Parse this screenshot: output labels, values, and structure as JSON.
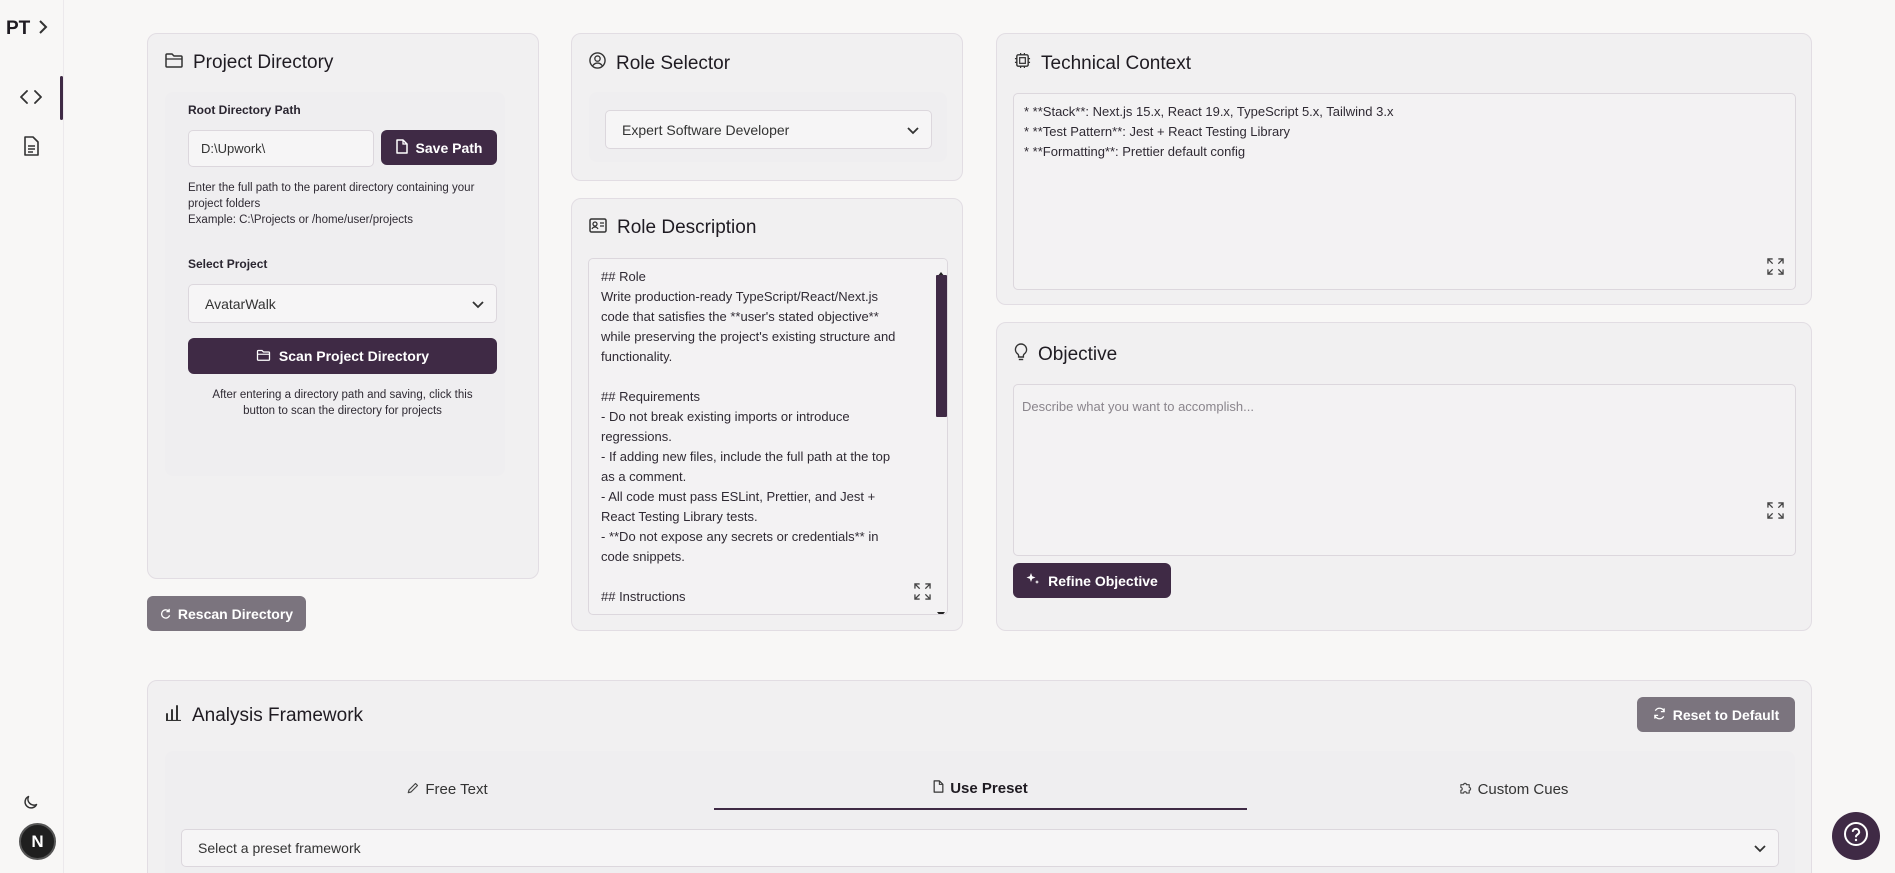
{
  "sidebar": {
    "brand": "PT",
    "brand_chevron": "›",
    "items": [
      {
        "name": "code-icon"
      },
      {
        "name": "document-icon"
      }
    ],
    "theme_icon": "moon-icon",
    "avatar_letter": "N"
  },
  "project_directory": {
    "title": "Project Directory",
    "root_label": "Root Directory Path",
    "root_value": "D:\\Upwork\\",
    "save_label": "Save Path",
    "help_line1": "Enter the full path to the parent directory containing your",
    "help_line2": "project folders",
    "example": "Example: C:\\Projects or /home/user/projects",
    "select_label": "Select Project",
    "selected_project": "AvatarWalk",
    "scan_label": "Scan Project Directory",
    "scan_help1": "After entering a directory path and saving, click this",
    "scan_help2": "button to scan the directory for projects",
    "rescan_label": "Rescan Directory"
  },
  "role_selector": {
    "title": "Role Selector",
    "selected_role": "Expert Software Developer"
  },
  "role_description": {
    "title": "Role Description",
    "text": "## Role\nWrite production-ready TypeScript/React/Next.js code that satisfies the **user's stated objective** while preserving the project's existing structure and functionality.\n\n## Requirements\n- Do not break existing imports or introduce regressions.\n- If adding new files, include the full path at the top as a comment.\n- All code must pass ESLint, Prettier, and Jest + React Testing Library tests.\n- **Do not expose any secrets or credentials** in code snippets.\n\n## Instructions"
  },
  "technical_context": {
    "title": "Technical Context",
    "text": "* **Stack**: Next.js 15.x, React 19.x, TypeScript 5.x, Tailwind 3.x\n* **Test Pattern**: Jest + React Testing Library\n* **Formatting**: Prettier default config"
  },
  "objective": {
    "title": "Objective",
    "placeholder": "Describe what you want to accomplish...",
    "refine_label": "Refine Objective"
  },
  "analysis_framework": {
    "title": "Analysis Framework",
    "reset_label": "Reset to Default",
    "tabs": [
      {
        "label": "Free Text",
        "icon": "pencil-icon"
      },
      {
        "label": "Use Preset",
        "icon": "file-icon",
        "active": true
      },
      {
        "label": "Custom Cues",
        "icon": "puzzle-icon"
      }
    ],
    "preset_placeholder": "Select a preset framework"
  },
  "colors": {
    "accent": "#3f2a45",
    "secondary_button": "#7b747e",
    "background": "#f8f7f6",
    "card": "#f1f0f1"
  }
}
